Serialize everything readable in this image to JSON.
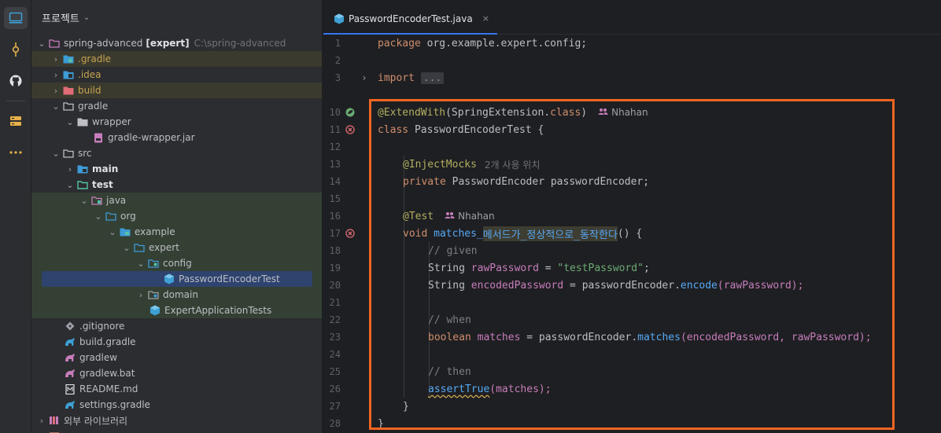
{
  "project_panel": {
    "title": "프로젝트",
    "root": {
      "name": "spring-advanced",
      "module": "[expert]",
      "path": "C:\\spring-advanced"
    },
    "items": [
      {
        "label": ".gradle"
      },
      {
        "label": ".idea"
      },
      {
        "label": "build"
      },
      {
        "label": "gradle"
      },
      {
        "label": "wrapper"
      },
      {
        "label": "gradle-wrapper.jar"
      },
      {
        "label": "src"
      },
      {
        "label": "main"
      },
      {
        "label": "test"
      },
      {
        "label": "java"
      },
      {
        "label": "org"
      },
      {
        "label": "example"
      },
      {
        "label": "expert"
      },
      {
        "label": "config"
      },
      {
        "label": "PasswordEncoderTest"
      },
      {
        "label": "domain"
      },
      {
        "label": "ExpertApplicationTests"
      },
      {
        "label": ".gitignore"
      },
      {
        "label": "build.gradle"
      },
      {
        "label": "gradlew"
      },
      {
        "label": "gradlew.bat"
      },
      {
        "label": "README.md"
      },
      {
        "label": "settings.gradle"
      },
      {
        "label": "외부 라이브러리"
      }
    ]
  },
  "editor": {
    "tab": {
      "label": "PasswordEncoderTest.java",
      "close": "×"
    },
    "line_numbers": [
      "1",
      "2",
      "3",
      "10",
      "11",
      "12",
      "13",
      "14",
      "15",
      "16",
      "17",
      "18",
      "19",
      "20",
      "21",
      "22",
      "23",
      "24",
      "25",
      "26",
      "27",
      "28"
    ],
    "code": {
      "l1": {
        "kw": "package",
        "rest": " org.example.expert.config;"
      },
      "l3": {
        "kw": "import",
        "fold": "..."
      },
      "l10": {
        "ann": "@ExtendWith",
        "p1": "(SpringExtension.",
        "kw": "class",
        "p2": ")",
        "author": "Nhahan"
      },
      "l11": {
        "kw": "class",
        "rest": " PasswordEncoderTest {"
      },
      "l13": {
        "ann": "@InjectMocks",
        "hint": "2개 사용 위치"
      },
      "l14": {
        "kw": "private",
        "type": " PasswordEncoder ",
        "fld": "passwordEncoder",
        "end": ";"
      },
      "l16": {
        "ann": "@Test",
        "author": "Nhahan"
      },
      "l17": {
        "kw": "void",
        "name": " matches_",
        "name_hl": "메서드가_정상적으로_동작한다",
        "end": "() {"
      },
      "l18": {
        "cmt": "// given"
      },
      "l19": {
        "type": "String ",
        "var": "rawPassword",
        "eq": " = ",
        "str": "\"testPassword\"",
        "end": ";"
      },
      "l20": {
        "type": "String ",
        "var": "encodedPassword",
        "eq": " = ",
        "fld": "passwordEncoder",
        "dot": ".",
        "mth": "encode",
        "args": "(rawPassword);"
      },
      "l22": {
        "cmt": "// when"
      },
      "l23": {
        "kw": "boolean",
        "var": " matches",
        "eq": " = ",
        "fld": "passwordEncoder",
        "dot": ".",
        "mth": "matches",
        "args": "(encodedPassword, rawPassword);"
      },
      "l25": {
        "cmt": "// then"
      },
      "l26": {
        "mth": "assertTrue",
        "args": "(matches);"
      },
      "l27": {
        "brace": "}"
      },
      "l28": {
        "brace": "}"
      }
    }
  },
  "colors": {
    "highlight_box": "#f26522",
    "accent": "#3574f0"
  }
}
